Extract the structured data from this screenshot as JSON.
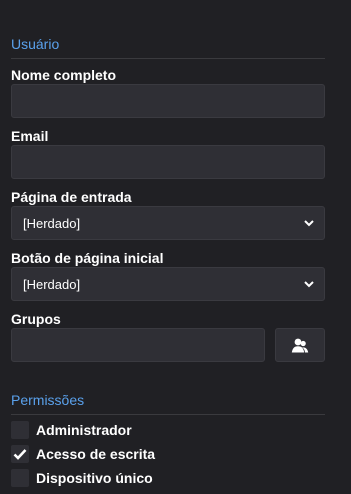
{
  "user_section": {
    "title": "Usuário",
    "full_name_label": "Nome completo",
    "full_name_value": "",
    "email_label": "Email",
    "email_value": "",
    "landing_page_label": "Página de entrada",
    "landing_page_value": "[Herdado]",
    "home_button_label": "Botão de página inicial",
    "home_button_value": "[Herdado]",
    "groups_label": "Grupos",
    "groups_button_icon": "user-group-icon"
  },
  "permissions_section": {
    "title": "Permissões",
    "items": [
      {
        "label": "Administrador",
        "checked": false
      },
      {
        "label": "Acesso de escrita",
        "checked": true
      },
      {
        "label": "Dispositivo único",
        "checked": false
      }
    ]
  },
  "colors": {
    "background": "#202024",
    "accent": "#5aa1ec",
    "field": "#2f2f35"
  }
}
